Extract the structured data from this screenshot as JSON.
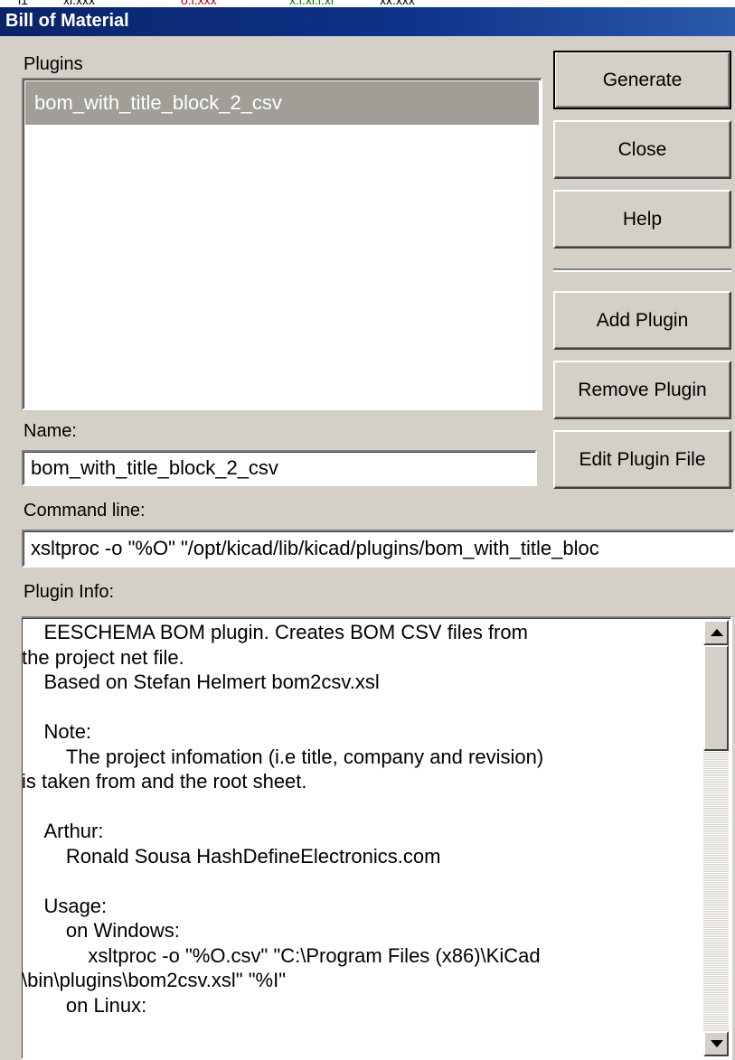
{
  "window": {
    "title": "Bill of Material"
  },
  "plugins": {
    "label": "Plugins",
    "items": [
      "bom_with_title_block_2_csv"
    ]
  },
  "buttons": {
    "generate": "Generate",
    "close": "Close",
    "help": "Help",
    "add_plugin": "Add Plugin",
    "remove_plugin": "Remove Plugin",
    "edit_plugin_file": "Edit Plugin File"
  },
  "name_field": {
    "label": "Name:",
    "value": "bom_with_title_block_2_csv"
  },
  "command_line": {
    "label": "Command line:",
    "value": "xsltproc -o \"%O\" \"/opt/kicad/lib/kicad/plugins/bom_with_title_bloc"
  },
  "plugin_info": {
    "label": "Plugin Info:",
    "text": "    EESCHEMA BOM plugin. Creates BOM CSV files from\nthe project net file.\n    Based on Stefan Helmert bom2csv.xsl\n\n    Note:\n        The project infomation (i.e title, company and revision)\nis taken from and the root sheet.\n\n    Arthur:\n        Ronald Sousa HashDefineElectronics.com\n\n    Usage:\n        on Windows:\n            xsltproc -o \"%O.csv\" \"C:\\Program Files (x86)\\KiCad\n\\bin\\plugins\\bom2csv.xsl\" \"%I\"\n        on Linux:"
  },
  "scrollbar": {
    "position_fraction": 0.0
  }
}
